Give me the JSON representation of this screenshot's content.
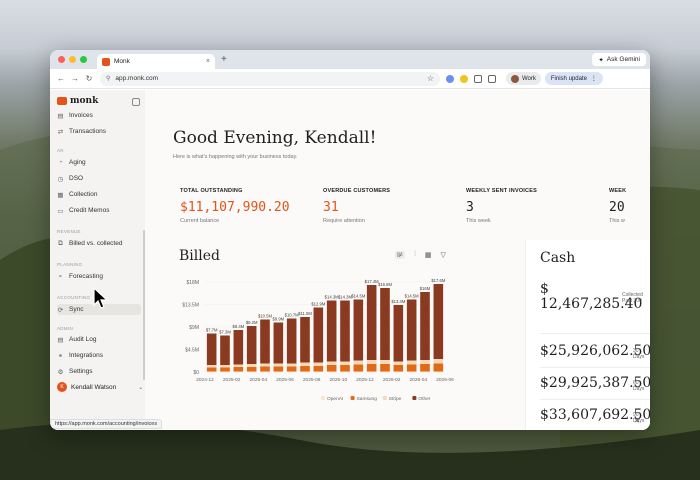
{
  "browser": {
    "tab_title": "Monk",
    "tab_close": "×",
    "new_tab": "+",
    "gemini_label": "Ask Gemini",
    "url": "app.monk.com",
    "profile": "Work",
    "finish_update": "Finish update",
    "status_url": "https://app.monk.com/accounting/invoices"
  },
  "sidebar": {
    "logo": "monk",
    "items_top": [
      {
        "icon": "▤",
        "label": "Invoices"
      },
      {
        "icon": "⇄",
        "label": "Transactions"
      }
    ],
    "group_ar": "AR",
    "items_ar": [
      {
        "icon": "◔",
        "label": "Aging"
      },
      {
        "icon": "◷",
        "label": "DSO"
      },
      {
        "icon": "▦",
        "label": "Collection"
      },
      {
        "icon": "▭",
        "label": "Credit Memos"
      }
    ],
    "group_revenue": "REVENUE",
    "items_revenue": [
      {
        "icon": "⧉",
        "label": "Billed vs. collected"
      }
    ],
    "group_planning": "PLANNING",
    "items_planning": [
      {
        "icon": "⌕",
        "label": "Forecasting"
      }
    ],
    "group_accounting": "ACCOUNTING",
    "items_accounting": [
      {
        "icon": "⟳",
        "label": "Sync"
      }
    ],
    "group_admin": "ADMIN",
    "items_admin": [
      {
        "icon": "▤",
        "label": "Audit Log"
      },
      {
        "icon": "⚭",
        "label": "Integrations"
      },
      {
        "icon": "⚙",
        "label": "Settings"
      }
    ],
    "user_name": "Kendall Watson",
    "user_initial": "K"
  },
  "main": {
    "greeting": "Good Evening, Kendall!",
    "subtitle": "Here is what's happening with your business today.",
    "kpis": [
      {
        "label": "TOTAL OUTSTANDING",
        "value": "$11,107,990.20",
        "caption": "Current balance"
      },
      {
        "label": "OVERDUE CUSTOMERS",
        "value": "31",
        "caption": "Require attention"
      },
      {
        "label": "WEEKLY SENT INVOICES",
        "value": "3",
        "caption": "This week"
      },
      {
        "label": "WEEK",
        "value": "20",
        "caption": "This w"
      }
    ],
    "billed_title": "Billed",
    "cash_title": "Cash",
    "cash_rows": [
      {
        "amount": "$ 12,467,285.40",
        "period": "Collected Past 300"
      },
      {
        "amount": "$25,926,062.50",
        "period": "30 Days"
      },
      {
        "amount": "$29,925,387.50",
        "period": "60 Days"
      },
      {
        "amount": "$33,607,692.50",
        "period": "90 Days"
      }
    ]
  },
  "colors": {
    "accent": "#e2541a",
    "other": "#8b3a22",
    "samsung": "#e26a16",
    "stripe": "#f3d9b8",
    "openai": "#f6e7d3"
  },
  "chart_data": {
    "type": "bar",
    "stacked": true,
    "categories": [
      "2024-12",
      "2025-01",
      "2025-02",
      "2025-03",
      "2025-04",
      "2025-05",
      "2025-06",
      "2025-07",
      "2025-08",
      "2025-09",
      "2025-10",
      "2025-11",
      "2025-12",
      "2026-01",
      "2026-02",
      "2026-03",
      "2026-04",
      "2026-05"
    ],
    "x_tick_labels": [
      "2024-12",
      "2025-02",
      "2025-04",
      "2025-06",
      "2025-08",
      "2025-10",
      "2025-12",
      "2026-02",
      "2026-04",
      "2026-06"
    ],
    "y_tick_labels": [
      "$18M",
      "$13.5M",
      "$9M",
      "$4.5M",
      "$0"
    ],
    "ylim": [
      0,
      18
    ],
    "data_labels": [
      "$7.7M",
      "$7.3M",
      "$8.4M",
      "$9.2M",
      "$10.5M",
      "$9.9M",
      "$10.7M",
      "$11.0M",
      "$12.9M",
      "$14.3M",
      "$14.3M",
      "$14.5M",
      "$17.4M",
      "$16.8M",
      "$13.4M",
      "$14.5M",
      "$16M",
      "$17.6M"
    ],
    "series": [
      {
        "name": "OpenAI",
        "values": [
          0.1,
          0.1,
          0.1,
          0.1,
          0.1,
          0.1,
          0.1,
          0.1,
          0.1,
          0.1,
          0.1,
          0.1,
          0.1,
          0.1,
          0.1,
          0.1,
          0.1,
          0.1
        ]
      },
      {
        "name": "Samsung",
        "values": [
          0.8,
          0.8,
          0.9,
          0.9,
          1.0,
          1.0,
          1.0,
          1.1,
          1.1,
          1.3,
          1.3,
          1.4,
          1.5,
          1.5,
          1.3,
          1.4,
          1.5,
          1.6
        ]
      },
      {
        "name": "Stripe",
        "values": [
          0.5,
          0.5,
          0.5,
          0.6,
          0.6,
          0.6,
          0.6,
          0.7,
          0.7,
          0.7,
          0.7,
          0.8,
          0.8,
          0.8,
          0.7,
          0.8,
          0.8,
          0.9
        ]
      },
      {
        "name": "Other",
        "values": [
          6.3,
          5.9,
          6.9,
          7.6,
          8.8,
          8.2,
          9.0,
          9.1,
          11.0,
          12.2,
          12.2,
          12.2,
          15.0,
          14.4,
          11.3,
          12.2,
          13.6,
          15.0
        ]
      }
    ],
    "legend_position": "bottom"
  }
}
